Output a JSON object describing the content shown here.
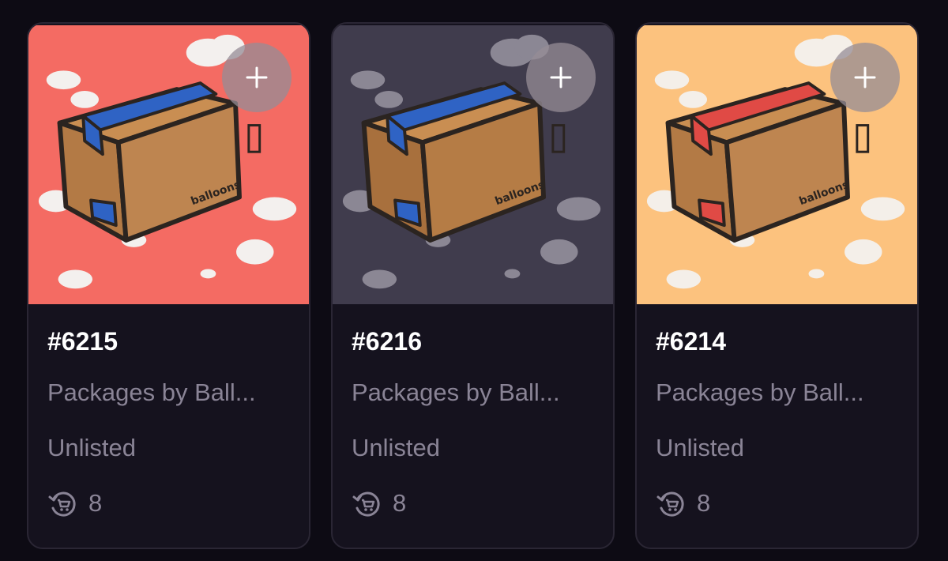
{
  "cards": [
    {
      "id": "#6215",
      "collection": "Packages by Ball...",
      "status": "Unlisted",
      "count": "8",
      "bg": "#f46b63",
      "cloud": "#f3f0ee",
      "tape": "#2f63c4",
      "add_icon": "plus-icon",
      "stat_icon": "cart-refresh-icon"
    },
    {
      "id": "#6216",
      "collection": "Packages by Ball...",
      "status": "Unlisted",
      "count": "8",
      "bg": "#403c4d",
      "cloud": "#8b8794",
      "tape": "#2f63c4",
      "add_icon": "plus-icon",
      "stat_icon": "cart-refresh-icon"
    },
    {
      "id": "#6214",
      "collection": "Packages by Ball...",
      "status": "Unlisted",
      "count": "8",
      "bg": "#fcc27e",
      "cloud": "#f4efe9",
      "tape": "#e04a45",
      "add_icon": "plus-icon",
      "stat_icon": "cart-refresh-icon"
    }
  ]
}
